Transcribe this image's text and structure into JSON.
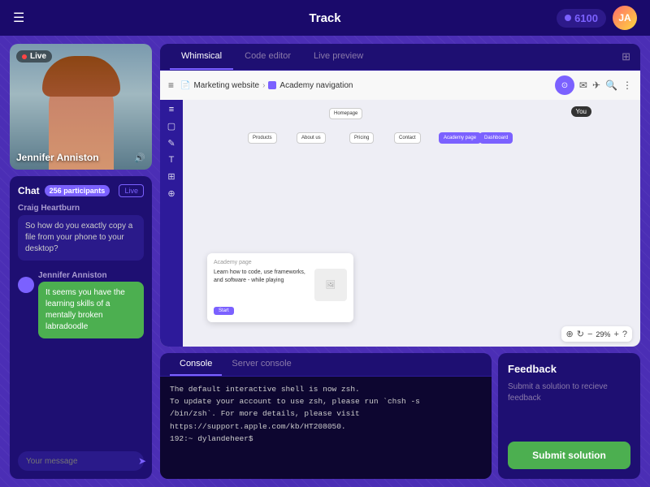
{
  "topNav": {
    "hamburger": "☰",
    "title": "Track",
    "score": "6100",
    "avatar_initials": "JA"
  },
  "video": {
    "live_label": "Live",
    "streamer_name": "Jennifer Anniston",
    "volume_icon": "🔊"
  },
  "chat": {
    "title": "Chat",
    "participants": "256 participants",
    "live_btn": "Live",
    "messages": [
      {
        "sender": "Craig Heartburn",
        "text": "So how do you exactly copy a file from your phone to your desktop?",
        "bubble_type": "gray"
      },
      {
        "sender": "Jennifer Anniston",
        "text": "It seems you have the learning skills of a mentally broken labradoodle",
        "bubble_type": "green"
      }
    ],
    "input_placeholder": "Your message"
  },
  "editor": {
    "tabs": [
      "Whimsical",
      "Code editor",
      "Live preview"
    ],
    "active_tab": "Whimsical",
    "breadcrumb": [
      "Marketing website",
      "Academy navigation"
    ],
    "you_badge": "You",
    "zoom_value": "29%",
    "academy_label": "Academy page",
    "academy_text": "Learn how to code, use frameworks, and software - while playing",
    "academy_btn": "Start"
  },
  "console": {
    "tabs": [
      "Console",
      "Server console"
    ],
    "active_tab": "Console",
    "output": [
      "The default interactive shell is now zsh.",
      "To update your account to use zsh, please run `chsh -s",
      "/bin/zsh`. For more details, please visit",
      "https://support.apple.com/kb/HT208050.",
      "192:~ dylandeheer$"
    ]
  },
  "feedback": {
    "title": "Feedback",
    "subtitle": "Submit a solution to recieve feedback",
    "submit_label": "Submit solution"
  },
  "tools": [
    "≡",
    "▢",
    "✎",
    "T",
    "⊞",
    "⊕"
  ],
  "toolbar_icons": [
    "⊙",
    "✉",
    "✈",
    "🔍",
    "⋮"
  ]
}
